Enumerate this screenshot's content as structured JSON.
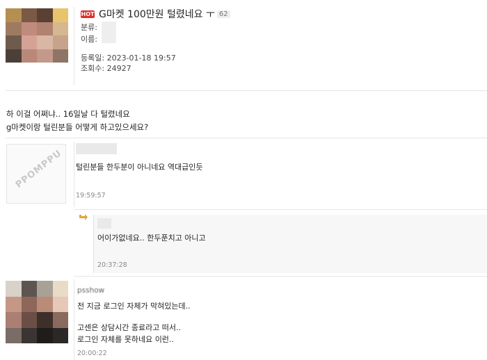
{
  "post": {
    "hot_badge": "HOT",
    "title": "G마켓 100만원 털렸네요 ㅜ",
    "comment_count": "62",
    "category_label": "분류:",
    "name_label": "이름:",
    "date_label": "등록일:",
    "date_value": "2023-01-18 19:57",
    "views_label": "조회수:",
    "views_value": "24927",
    "body_line1": "하 이걸 어쩌냐.. 16일날 다 털렸네요",
    "body_line2": "g마켓이랑 털린분들 어떻게 하고있으세요?"
  },
  "comments": [
    {
      "avatar_text": "PPOMPPU",
      "text": "털린분들 한두분이 아니네요 역대급인듯",
      "time": "19:59:57"
    },
    {
      "text": "어이가없네요.. 한두푼치고 아니고",
      "time": "20:37:28"
    },
    {
      "username": "psshow",
      "line1": "전 지금 로그인 자체가 막혀있는데..",
      "line2": "고센은 상담시간 종료라고 떠서..",
      "line3": "로그인 자체를 못하네요 이런..",
      "time": "20:00:22"
    }
  ],
  "colors": {
    "hot_badge": "#e02b2b",
    "reply_bg": "#f7f7f7",
    "reply_arrow": "#e8a33a"
  },
  "icons": {
    "reply": "reply-arrow-icon"
  }
}
